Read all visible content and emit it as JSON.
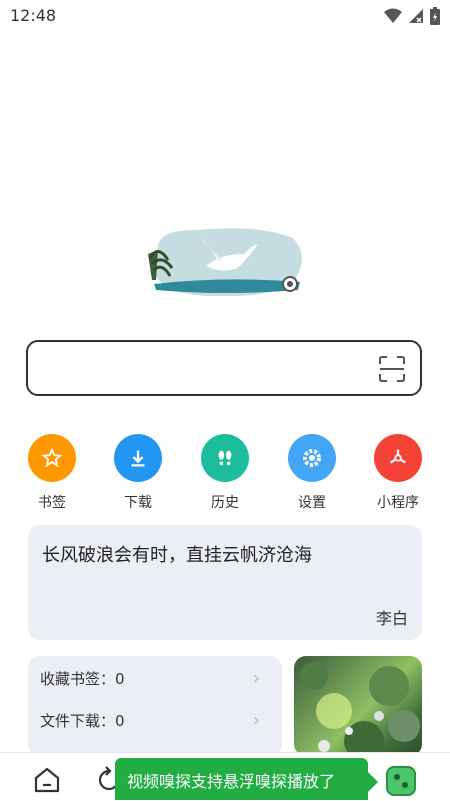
{
  "status_bar": {
    "time": "12:48"
  },
  "search": {
    "placeholder": ""
  },
  "quick_actions": [
    {
      "label": "书签",
      "icon": "star-icon",
      "color": "#ff9800"
    },
    {
      "label": "下载",
      "icon": "download-icon",
      "color": "#2196f3"
    },
    {
      "label": "历史",
      "icon": "footprints-icon",
      "color": "#1bbd9c"
    },
    {
      "label": "设置",
      "icon": "gear-icon",
      "color": "#42a5f5"
    },
    {
      "label": "小程序",
      "icon": "mini-program-icon",
      "color": "#f44336"
    }
  ],
  "quote": {
    "text": "长风破浪会有时，直挂云帆济沧海",
    "author": "李白"
  },
  "stats": [
    {
      "label": "收藏书签：0"
    },
    {
      "label": "文件下载：0"
    }
  ],
  "toast": {
    "text": "视频嗅探支持悬浮嗅探播放了"
  },
  "colors": {
    "toast_bg": "#22ad43",
    "card_bg": "#eceef5"
  }
}
